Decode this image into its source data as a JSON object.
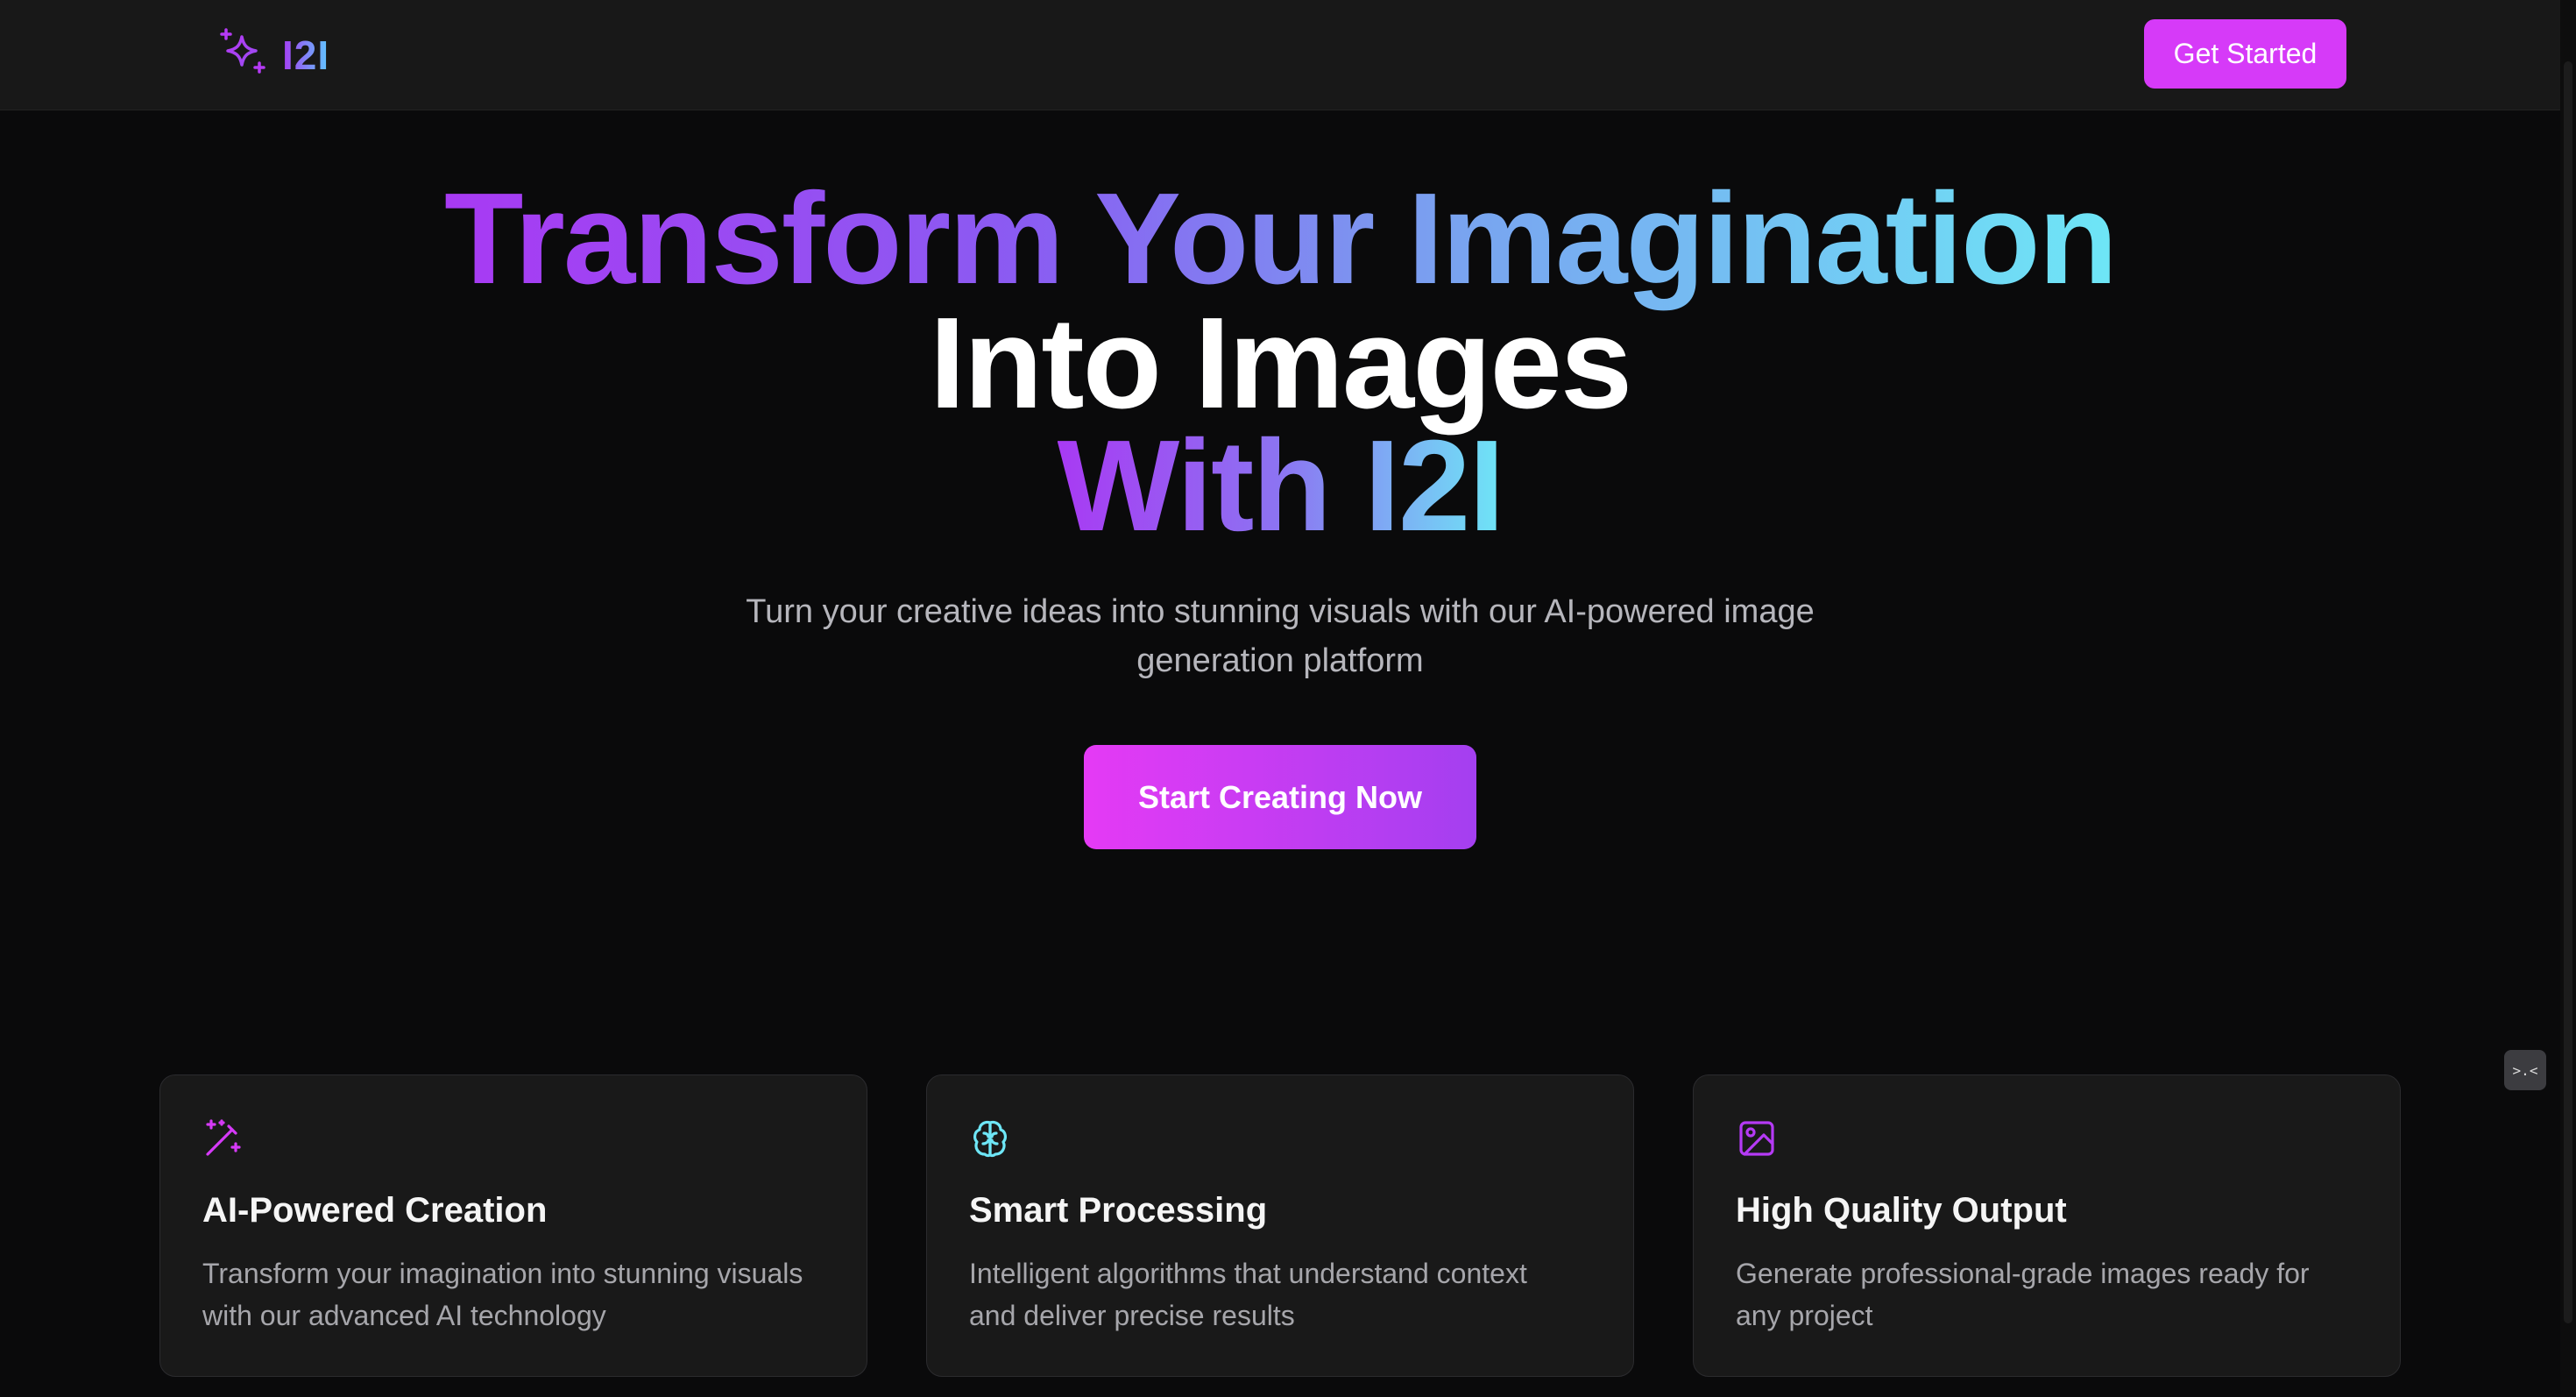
{
  "nav": {
    "logo_text": "I2I",
    "get_started": "Get Started"
  },
  "hero": {
    "line1": "Transform Your Imagination",
    "line2": "Into Images",
    "line3": "With I2I",
    "subtitle_line1": "Turn your creative ideas into stunning visuals with our AI-powered image",
    "subtitle_line2": "generation platform",
    "cta": "Start Creating Now"
  },
  "features": [
    {
      "icon": "magic-wand-icon",
      "title": "AI-Powered Creation",
      "desc_line1": "Transform your imagination into stunning visuals",
      "desc_line2": "with our advanced AI technology",
      "color": "#d63af8"
    },
    {
      "icon": "brain-icon",
      "title": "Smart Processing",
      "desc_line1": "Intelligent algorithms that understand context",
      "desc_line2": "and deliver precise results",
      "color": "#6ee6f6"
    },
    {
      "icon": "image-icon",
      "title": "High Quality Output",
      "desc_line1": "Generate professional-grade images ready for",
      "desc_line2": "any project",
      "color": "#b53af5"
    }
  ],
  "floating_button": {
    "icon": "dev-tools-icon",
    "label": ">.<"
  },
  "colors": {
    "accent": "#d63af8",
    "gradient_start": "#a83af3",
    "gradient_end": "#6ee6f6",
    "background": "#0a0a0b",
    "nav_bg": "#181818"
  }
}
